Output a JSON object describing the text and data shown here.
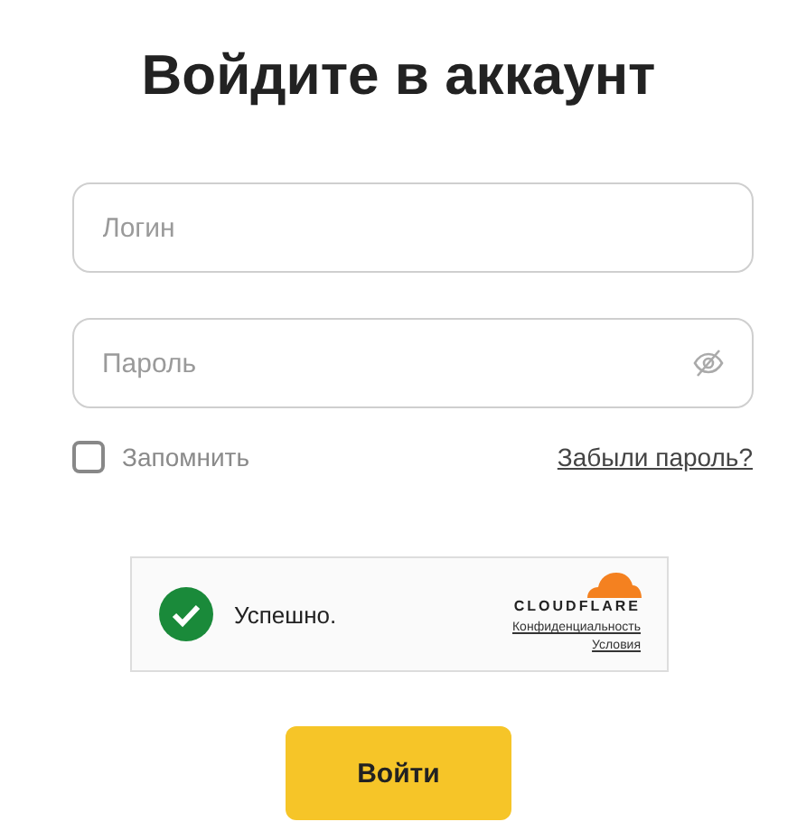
{
  "title": "Войдите в аккаунт",
  "login": {
    "placeholder": "Логин"
  },
  "password": {
    "placeholder": "Пароль"
  },
  "remember": {
    "label": "Запомнить",
    "checked": false
  },
  "forgot": "Забыли пароль?",
  "captcha": {
    "status": "Успешно.",
    "success": true,
    "brand": "CLOUDFLARE",
    "links": [
      "Конфиденциальность",
      "Условия"
    ]
  },
  "submit": "Войти"
}
